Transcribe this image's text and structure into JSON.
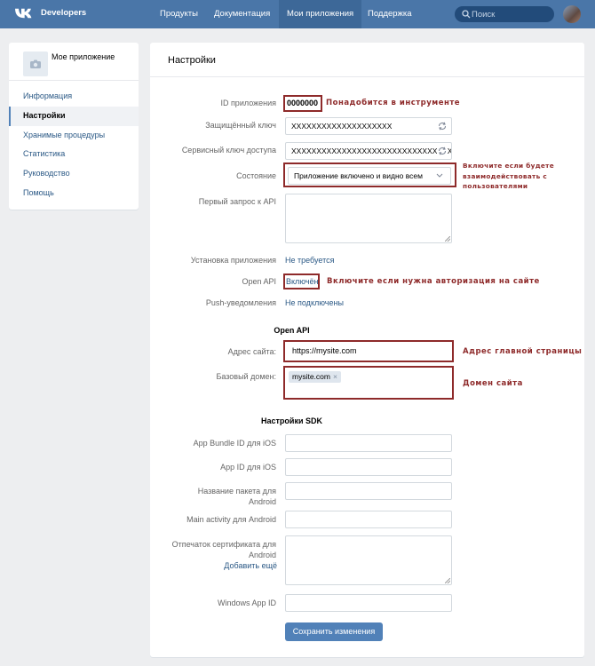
{
  "header": {
    "logo_text": "Developers",
    "nav": [
      "Продукты",
      "Документация",
      "Мои приложения",
      "Поддержка"
    ],
    "search_placeholder": "Поиск"
  },
  "sidebar": {
    "app_name": "Мое приложение",
    "items": [
      "Информация",
      "Настройки",
      "Хранимые процедуры",
      "Статистика",
      "Руководство",
      "Помощь"
    ],
    "active_index": 1
  },
  "settings": {
    "title": "Настройки",
    "app_id_label": "ID приложения",
    "app_id_value": "0000000",
    "secure_key_label": "Защищённый ключ",
    "secure_key_value": "XXXXXXXXXXXXXXXXXXXX",
    "service_key_label": "Сервисный ключ доступа",
    "service_key_value": "XXXXXXXXXXXXXXXXXXXXXXXXXXXXXXXXXXXXXX",
    "state_label": "Состояние",
    "state_value": "Приложение включено и видно всем",
    "first_request_label": "Первый запрос к API",
    "install_label": "Установка приложения",
    "install_value": "Не требуется",
    "open_api_label": "Open API",
    "open_api_value": "Включён",
    "push_label": "Push-уведомления",
    "push_value": "Не подключены",
    "open_api_section": "Open API",
    "site_label": "Адрес сайта:",
    "site_value": "https://mysite.com",
    "domain_label": "Базовый домен:",
    "domain_chip": "mysite.com",
    "domain_chip_remove": "×",
    "sdk_section": "Настройки SDK",
    "ios_bundle_label": "App Bundle ID для iOS",
    "ios_app_id_label": "App ID для iOS",
    "android_package_label": "Название пакета для Android",
    "android_activity_label": "Main activity для Android",
    "android_cert_label": "Отпечаток сертификата для Android",
    "add_more": "Добавить ещё",
    "windows_label": "Windows App ID",
    "save_button": "Сохранить изменения"
  },
  "annotations": {
    "app_id_note": "Понадобится в инструменте",
    "state_note": "Включите если будете взаимодействовать с пользователями",
    "open_api_note": "Включите если нужна авторизация на сайте",
    "site_note": "Адрес главной страницы",
    "domain_note": "Домен сайта"
  },
  "colors": {
    "header_bg": "#4a76a8",
    "link": "#2a5885",
    "button": "#5181b8",
    "annotation": "#8e2a2a"
  }
}
